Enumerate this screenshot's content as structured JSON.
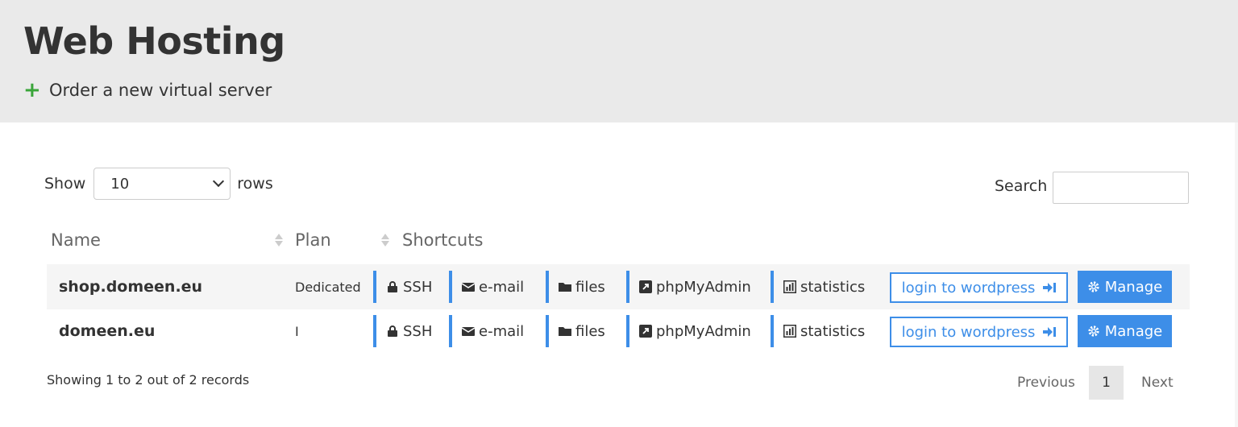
{
  "header": {
    "title": "Web Hosting",
    "order_label": "Order a new virtual server",
    "order_icon": "plus-icon"
  },
  "controls": {
    "show_label": "Show",
    "rows_label": "rows",
    "page_size": "10",
    "search_label": "Search",
    "search_value": ""
  },
  "table": {
    "columns": [
      "Name",
      "Plan",
      "Shortcuts"
    ],
    "rows": [
      {
        "name": "shop.domeen.eu",
        "plan": "Dedicated",
        "shortcuts": {
          "ssh": "SSH",
          "email": "e-mail",
          "files": "files",
          "pma": "phpMyAdmin",
          "stats": "statistics"
        },
        "login": "login to wordpress",
        "manage": "Manage"
      },
      {
        "name": "domeen.eu",
        "plan": "I",
        "shortcuts": {
          "ssh": "SSH",
          "email": "e-mail",
          "files": "files",
          "pma": "phpMyAdmin",
          "stats": "statistics"
        },
        "login": "login to wordpress",
        "manage": "Manage"
      }
    ]
  },
  "footer": {
    "showing": "Showing 1 to 2 out of 2 records",
    "previous": "Previous",
    "current_page": "1",
    "next": "Next"
  },
  "colors": {
    "accent": "#3d8ee8",
    "plus": "#3aa53a",
    "header_bg": "#eaeaea"
  }
}
